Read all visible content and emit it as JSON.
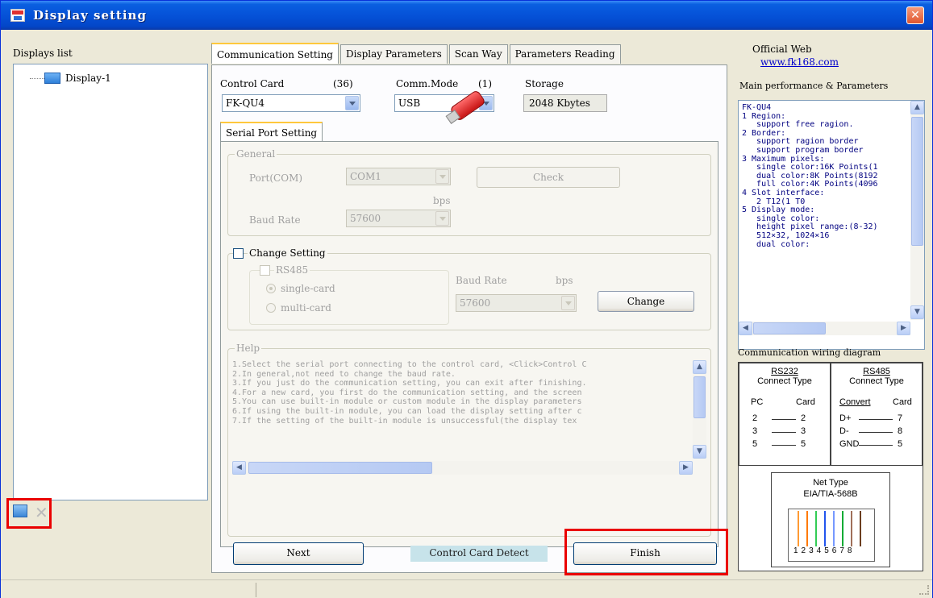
{
  "window": {
    "title": "Display setting",
    "close_glyph": "✕"
  },
  "left_panel": {
    "label": "Displays list",
    "items": [
      {
        "label": "Display-1",
        "icon": "monitor-icon"
      }
    ],
    "add_icon": "monitor-add-icon",
    "delete_glyph": "✕"
  },
  "tabs": [
    {
      "label": "Communication Setting",
      "active": true
    },
    {
      "label": "Display Parameters",
      "active": false
    },
    {
      "label": "Scan Way",
      "active": false
    },
    {
      "label": "Parameters Reading",
      "active": false
    }
  ],
  "control_card": {
    "label": "Control Card",
    "count": "(36)",
    "value": "FK-QU4"
  },
  "comm_mode": {
    "label": "Comm.Mode",
    "count": "(1)",
    "value": "USB"
  },
  "storage": {
    "label": "Storage",
    "value": "2048 Kbytes"
  },
  "serial_port": {
    "subtab_label": "Serial Port Setting",
    "general": {
      "title": "General",
      "port_label": "Port(COM)",
      "port_value": "COM1",
      "check_label": "Check",
      "bps_label": "bps",
      "baud_label": "Baud Rate",
      "baud_value": "57600"
    },
    "change_setting": {
      "title": "Change Setting",
      "rs485_label": "RS485",
      "single_card": "single-card",
      "multi_card": "multi-card",
      "baud_label": "Baud Rate",
      "bps_label": "bps",
      "baud_value": "57600",
      "change_label": "Change"
    },
    "help": {
      "title": "Help",
      "lines": [
        "1.Select the serial port connecting to the control card, <Click>Control C",
        "2.In general,not need to change the baud rate.",
        "3.If you just do the communication setting, you can exit after finishing.",
        "4.For a new card, you first do the communication setting, and the screen",
        "5.You can use built-in module or custom module in the display parameters",
        "6.If using the built-in module, you can load the display setting after c",
        "7.If the setting of the built-in module is unsuccessful(the display tex"
      ]
    }
  },
  "footer": {
    "next": "Next",
    "detect": "Control Card Detect",
    "finish": "Finish"
  },
  "right_panel": {
    "official_label": "Official Web",
    "official_link": "www.fk168.com",
    "perf_label": "Main performance & Parameters",
    "perf_text": "FK-QU4\n1 Region:\n   support free ragion.\n2 Border:\n   support ragion border\n   support program border\n3 Maximum pixels:\n   single color:16K Points(1\n   dual color:8K Points(8192\n   full color:4K Points(4096\n4 Slot interface:\n   2 T12(1 T0\n5 Display mode:\n   single color:\n   height pixel range:(8-32)\n   512×32, 1024×16\n   dual color:",
    "wiring_label": "Communication wiring diagram",
    "rs232": {
      "title": "RS232",
      "sub": "Connect Type",
      "left_head": "PC",
      "right_head": "Card",
      "rows": [
        [
          "2",
          "2"
        ],
        [
          "3",
          "3"
        ],
        [
          "5",
          "5"
        ]
      ]
    },
    "rs485": {
      "title": "RS485",
      "sub": "Connect Type",
      "left_head": "Convert",
      "right_head": "Card",
      "rows": [
        [
          "D+",
          "7"
        ],
        [
          "D-",
          "8"
        ],
        [
          "GND",
          "5"
        ]
      ]
    },
    "net": {
      "title": "Net Type",
      "standard": "EIA/TIA-568B",
      "pins": "12345678"
    }
  },
  "colors": {
    "titlebar": "#0552d8",
    "highlight": "#ea0000",
    "link": "#0000cc",
    "detect_bg": "#c7e3ea"
  }
}
